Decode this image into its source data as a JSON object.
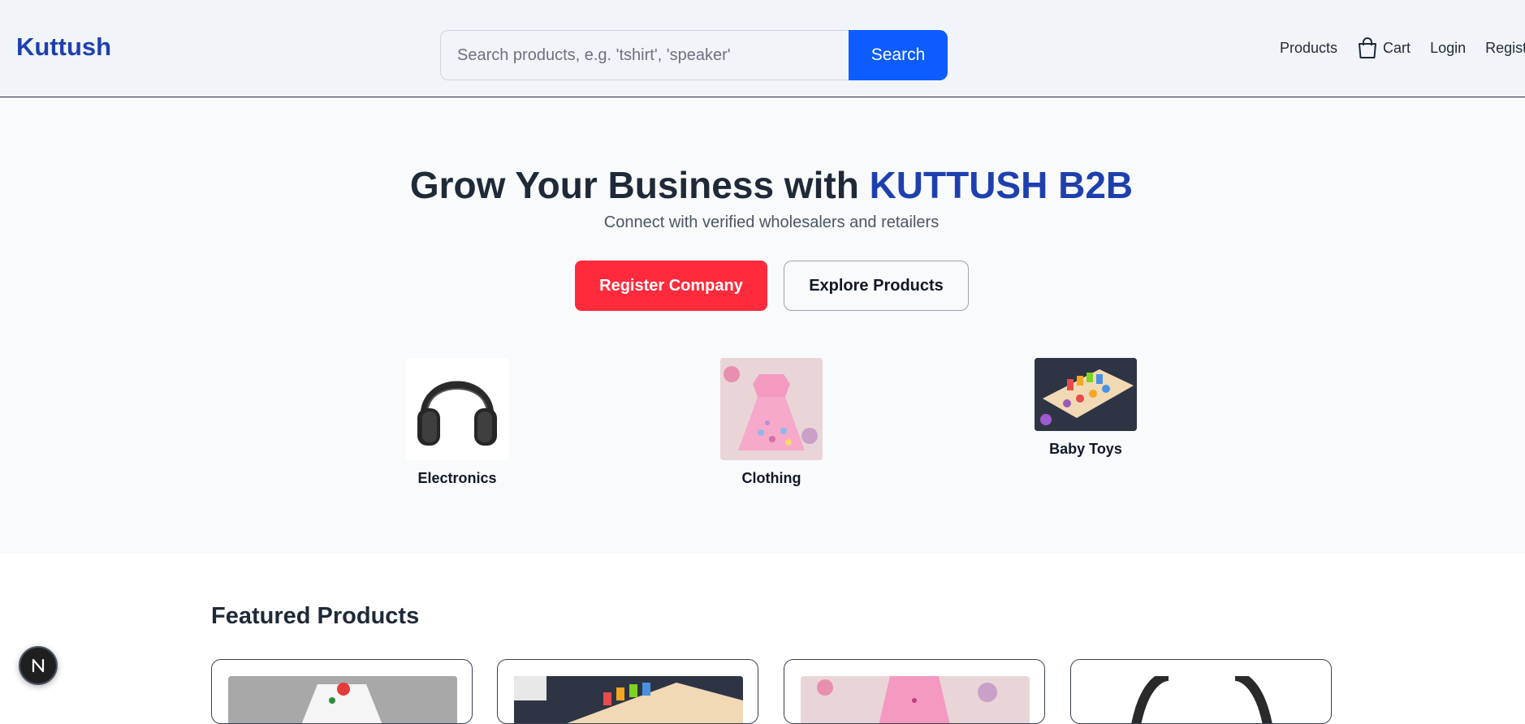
{
  "header": {
    "logo": "Kuttush",
    "search": {
      "placeholder": "Search products, e.g. 'tshirt', 'speaker'",
      "button_label": "Search"
    },
    "nav": {
      "products": "Products",
      "cart": "Cart",
      "login": "Login",
      "register": "Register"
    }
  },
  "hero": {
    "title_prefix": "Grow Your Business with ",
    "title_brand": "KUTTUSH B2B",
    "subtitle": "Connect with verified wholesalers and retailers",
    "primary_button": "Register Company",
    "secondary_button": "Explore Products"
  },
  "categories": [
    {
      "label": "Electronics",
      "icon": "headphones-image"
    },
    {
      "label": "Clothing",
      "icon": "pink-dress-image"
    },
    {
      "label": "Baby Toys",
      "icon": "wooden-number-puzzle-image"
    }
  ],
  "featured": {
    "title": "Featured Products",
    "cards": [
      {
        "image": "floral-shirt-image"
      },
      {
        "image": "toy-puzzle-image"
      },
      {
        "image": "pink-dress-image"
      },
      {
        "image": "headphones-image"
      }
    ]
  },
  "fab": {
    "label": "N"
  },
  "colors": {
    "brand": "#1e40af",
    "search": "#0d5cff",
    "cta": "#ff2a3b"
  }
}
